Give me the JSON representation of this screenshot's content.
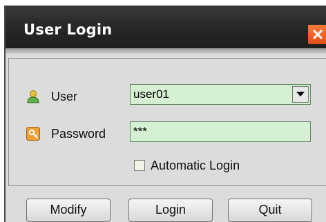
{
  "window": {
    "title": "User Login",
    "close_icon": "close-icon",
    "accent": "#e0501a"
  },
  "form": {
    "user": {
      "label": "User",
      "value": "user01",
      "icon": "user-icon"
    },
    "password": {
      "label": "Password",
      "value": "***",
      "icon": "key-icon"
    },
    "auto_login": {
      "label": "Automatic Login",
      "checked": false
    },
    "field_color": "#d6f0d3"
  },
  "buttons": {
    "modify": "Modify",
    "login": "Login",
    "quit": "Quit"
  }
}
